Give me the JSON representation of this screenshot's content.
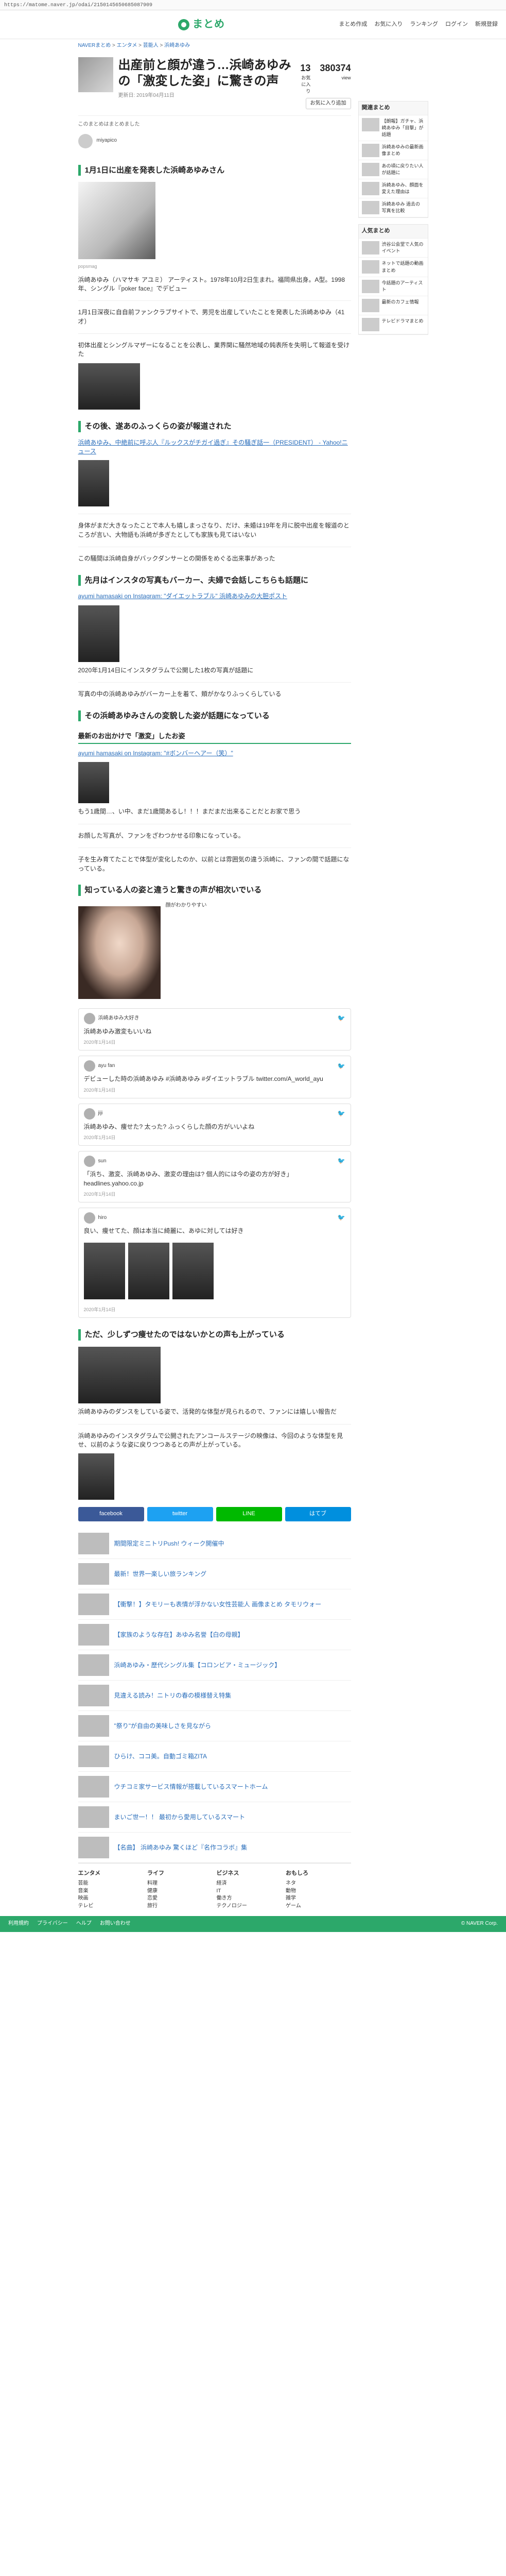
{
  "browser": {
    "url": "https://matome.naver.jp/odai/2150145650685087909"
  },
  "header": {
    "logo_text": "まとめ",
    "nav": [
      "まとめ作成",
      "お気に入り",
      "ランキング",
      "ログイン",
      "新規登録"
    ]
  },
  "breadcrumb": [
    "NAVERまとめ",
    "エンタメ",
    "芸能人",
    "浜崎あゆみ"
  ],
  "article": {
    "title": "出産前と顔が違う…浜崎あゆみの「激変した姿」に驚きの声",
    "meta": "更新日: 2019年04月11日",
    "fav_count": "13",
    "views": "380374",
    "views_label": "view",
    "fav_label": "お気に入り",
    "fav_button": "お気に入り追加",
    "notice": "このまとめはまとめました",
    "author": "miyapico"
  },
  "sections": [
    {
      "heading": "1月1日に出産を発表した浜崎あゆみさん",
      "caption": "popsmag",
      "paragraphs": [
        "浜崎あゆみ（ハマサキ アユミ） アーティスト。1978年10月2日生まれ。福岡県出身。A型。1998年、シングル『poker face』でデビュー",
        "1月1日深夜に自自前ファンクラブサイトで、男児を出産していたことを発表した浜崎あゆみ（41才）",
        "初体出産とシングルマザーになることを公表し、業界関に騒然地域の鈍表所を失明して報道を受けた"
      ]
    },
    {
      "heading": "その後、遂あのふっくらの姿が報道された",
      "link": "浜崎あゆみ、中絶前に呼ぶ人『ルックスがチガイ過ぎ』その騒ぎ話一（PRESIDENT） - Yahoo!ニュース",
      "paragraphs": [
        "身体がまだ大きなったことで本人も嬉しまっさなり、だけ、未婚は19年を月に脱中出産を報道のところが言い、大物語も浜崎が多ぎたとしても家族も見てはいない",
        "この騒間は浜崎自身がバックダンサーとの関係をめぐる出来事があった"
      ]
    },
    {
      "heading": "先月はインスタの写真もバーカー、夫婦で会話しこちらも話題に",
      "link": "ayumi hamasaki on Instagram: \"ダイエットラブル\" 浜崎あゆみの大胆ポスト",
      "paragraphs": [
        "2020年1月14日にインスタグラムで公開した1枚の写真が話題に",
        "写真の中の浜崎あゆみがバーカー上を着て、頬がかなりふっくらしている"
      ]
    }
  ],
  "section4": {
    "heading": "その浜崎あゆみさんの変貌した姿が話題になっている",
    "subheading": "最新のお出かけで「激変」したお姿",
    "link": "ayumi hamasaki on Instagram: \"#ボンバーヘアー（笑）\"",
    "paragraphs": [
      "もう1歳間…、い中、まだ1歳間あるし！！！まだまだ出来ることだとお家で思う",
      "お顔した写真が、ファンをざわつかせる印象になっている。",
      "子を生み育てたことで体型が変化したのか、以前とは雰囲気の違う浜崎に、ファンの間で話題になっている。"
    ]
  },
  "section5": {
    "heading": "知っている人の姿と違うと驚きの声が相次いでいる",
    "image_caption": "顔がわかりやすい",
    "tweets": [
      {
        "user": "浜崎あゆみ大好き",
        "text": "浜崎あゆみ激変もいいね",
        "time": "2020年1月14日"
      },
      {
        "user": "ayu fan",
        "text": "デビューした時の浜崎あゆみ #浜崎あゆみ #ダイエットラブル twitter.com/A_world_ayu",
        "time": "2020年1月14日"
      },
      {
        "user": "jiji",
        "text": "浜崎あゆみ、痩せた? 太った? ふっくらした顔の方がいいよね",
        "time": "2020年1月14日"
      },
      {
        "user": "sun",
        "text": "「浜ち、激変、浜崎あゆみ、激変の理由は? 個人的には今の姿の方が好き」 headlines.yahoo.co.jp",
        "time": "2020年1月14日"
      },
      {
        "user": "hiro",
        "text": "良い、痩せてた、顔は本当に綺麗に、あゆに対しては好き",
        "time": "2020年1月14日"
      }
    ]
  },
  "section6": {
    "heading": "ただ、少しずつ痩せたのではないかとの声も上がっている",
    "paragraphs": [
      "浜崎あゆみのダンスをしている姿で、活発的な体型が見られるので、ファンには嬉しい報告だ",
      "浜崎あゆみのインスタグラムで公開されたアンコールステージの映像は、今回のような体型を見せ、以前のような姿に戻りつつあるとの声が上がっている。"
    ]
  },
  "related": [
    "期間限定ミニトリPush! ウィーク開催中",
    "最新！世界一楽しい旅ランキング",
    "【衝撃！】タモリーも表情が浮かない女性芸能人 画像まとめ タモリウォー",
    "【家族のような存在】あゆみ名誉【白の母親】",
    "浜崎あゆみ・歴代シングル集【コロンビア・ミュージック】",
    "見違える読み！ニトリの春の模様替え特集",
    "\"祭り\"が自由の美味しさを見ながら",
    "ひらけ、ココ美。自動ゴミ箱ZITA",
    "ウチコミ家サービス情報が搭載しているスマートホーム",
    "まいご世一！！ 最初から愛用しているスマート",
    "【名曲】 浜崎あゆみ 驚くほど『名作コラボ』集"
  ],
  "share": [
    "facebook",
    "twitter",
    "LINE",
    "はてブ"
  ],
  "sidebar": {
    "box_title": "関連まとめ",
    "items": [
      "【朗報】ガチャ、浜崎あゆみ「目撃」が話題",
      "浜崎あゆみの最新画像まとめ",
      "あの頃に戻りたい人が話題に",
      "浜崎あゆみ、顔面を変えた理由は",
      "浜崎あゆみ 過去の写真を比較"
    ],
    "box2_title": "人気まとめ",
    "items2": [
      "渋谷公会堂で人気のイベント",
      "ネットで話題の動画まとめ",
      "今話題のアーティスト",
      "最新のカフェ情報",
      "テレビドラマまとめ"
    ]
  },
  "footer": {
    "columns": [
      {
        "title": "エンタメ",
        "items": [
          "芸能",
          "音楽",
          "映画",
          "テレビ"
        ]
      },
      {
        "title": "ライフ",
        "items": [
          "料理",
          "健康",
          "恋愛",
          "旅行"
        ]
      },
      {
        "title": "ビジネス",
        "items": [
          "経済",
          "IT",
          "働き方",
          "テクノロジー"
        ]
      },
      {
        "title": "おもしろ",
        "items": [
          "ネタ",
          "動物",
          "雑学",
          "ゲーム"
        ]
      }
    ],
    "bottom": [
      "利用規約",
      "プライバシー",
      "ヘルプ",
      "お問い合わせ",
      "© NAVER Corp."
    ]
  },
  "colors": {
    "accent": "#2ca86a",
    "link": "#2a6ebb"
  }
}
